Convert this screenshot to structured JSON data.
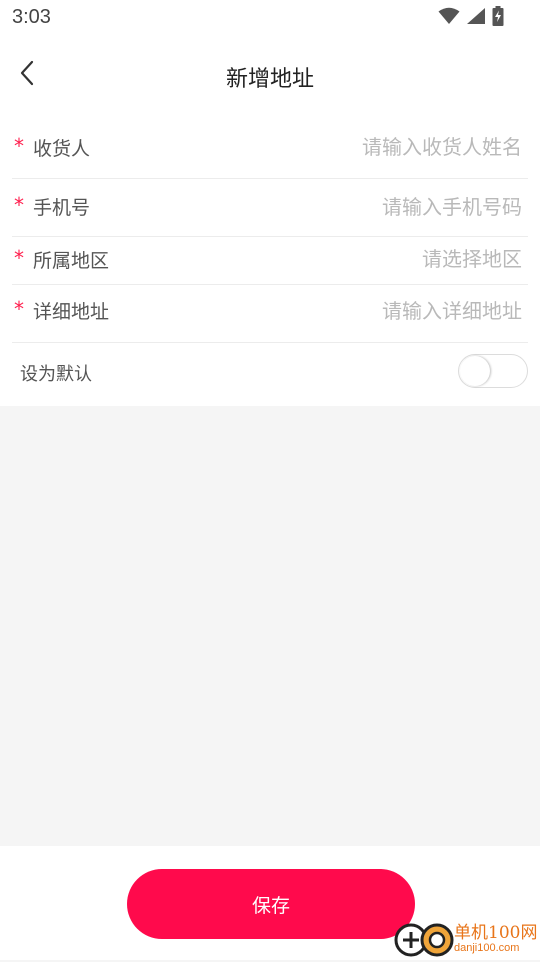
{
  "status_bar": {
    "time": "3:03",
    "icons": [
      "wifi-icon",
      "signal-icon",
      "battery-charging-icon"
    ]
  },
  "header": {
    "back_icon": "chevron-left-icon",
    "title": "新增地址"
  },
  "form": {
    "required_mark": "*",
    "fields": [
      {
        "label": "收货人",
        "placeholder": "请输入收货人姓名",
        "value": ""
      },
      {
        "label": "手机号",
        "placeholder": "请输入手机号码",
        "value": ""
      },
      {
        "label": "所属地区",
        "placeholder": "请选择地区",
        "value": ""
      },
      {
        "label": "详细地址",
        "placeholder": "请输入详细地址",
        "value": ""
      }
    ],
    "default": {
      "label": "设为默认",
      "enabled": false
    }
  },
  "footer": {
    "save_label": "保存"
  },
  "watermark": {
    "title": "单机100网",
    "url": "danji100.com"
  },
  "colors": {
    "accent": "#ff0a4c",
    "required": "#ff1f4e",
    "placeholder": "#b9b9b9",
    "background": "#f5f5f5",
    "watermark": "#e8751a"
  }
}
